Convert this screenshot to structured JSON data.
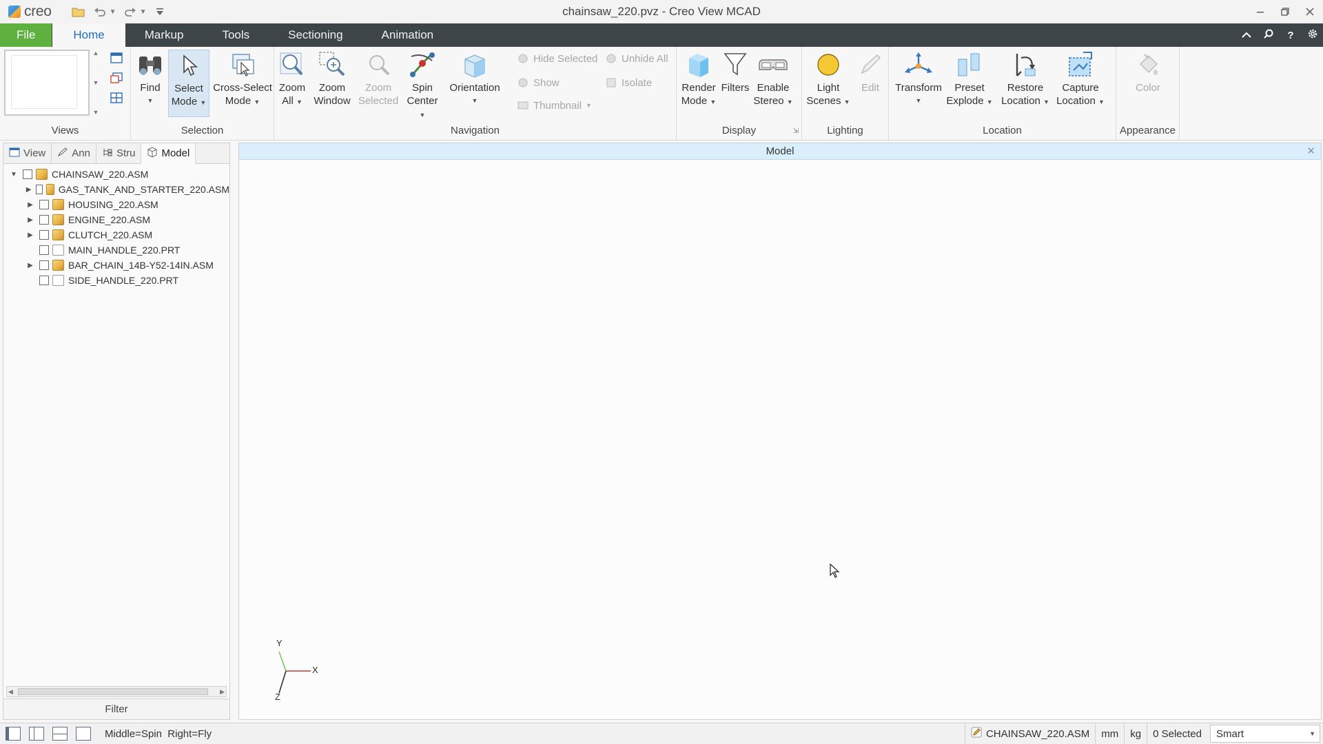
{
  "app": {
    "logo_text": "creo",
    "window_title": "chainsaw_220.pvz - Creo View MCAD"
  },
  "menu_tabs": {
    "file": "File",
    "home": "Home",
    "markup": "Markup",
    "tools": "Tools",
    "sectioning": "Sectioning",
    "animation": "Animation"
  },
  "ribbon": {
    "groups": {
      "views": "Views",
      "selection": "Selection",
      "navigation": "Navigation",
      "display": "Display",
      "lighting": "Lighting",
      "location": "Location",
      "appearance": "Appearance"
    },
    "find": "Find",
    "select_mode_1": "Select",
    "select_mode_2": "Mode",
    "cross_select_1": "Cross-Select",
    "cross_select_2": "Mode",
    "zoom_all_1": "Zoom",
    "zoom_all_2": "All",
    "zoom_window_1": "Zoom",
    "zoom_window_2": "Window",
    "zoom_selected_1": "Zoom",
    "zoom_selected_2": "Selected",
    "spin_center_1": "Spin",
    "spin_center_2": "Center",
    "orientation": "Orientation",
    "hide_selected": "Hide Selected",
    "unhide_all": "Unhide All",
    "show": "Show",
    "isolate": "Isolate",
    "thumbnail": "Thumbnail",
    "render_mode_1": "Render",
    "render_mode_2": "Mode",
    "filters": "Filters",
    "enable_stereo_1": "Enable",
    "enable_stereo_2": "Stereo",
    "light_scenes_1": "Light",
    "light_scenes_2": "Scenes",
    "edit": "Edit",
    "transform": "Transform",
    "preset_explode_1": "Preset",
    "preset_explode_2": "Explode",
    "restore_location_1": "Restore",
    "restore_location_2": "Location",
    "capture_location_1": "Capture",
    "capture_location_2": "Location",
    "color": "Color"
  },
  "left_panel": {
    "tabs": [
      "View",
      "Ann",
      "Stru",
      "Model"
    ],
    "active_tab": "Model",
    "tree": [
      {
        "label": "CHAINSAW_220.ASM",
        "type": "asm",
        "expanded": true,
        "level": 0
      },
      {
        "label": "GAS_TANK_AND_STARTER_220.ASM",
        "type": "asm",
        "expanded": false,
        "level": 1
      },
      {
        "label": "HOUSING_220.ASM",
        "type": "asm",
        "expanded": false,
        "level": 1
      },
      {
        "label": "ENGINE_220.ASM",
        "type": "asm",
        "expanded": false,
        "level": 1
      },
      {
        "label": "CLUTCH_220.ASM",
        "type": "asm",
        "expanded": false,
        "level": 1
      },
      {
        "label": "MAIN_HANDLE_220.PRT",
        "type": "prt",
        "expanded": null,
        "level": 1
      },
      {
        "label": "BAR_CHAIN_14B-Y52-14IN.ASM",
        "type": "asm",
        "expanded": false,
        "level": 1
      },
      {
        "label": "SIDE_HANDLE_220.PRT",
        "type": "prt",
        "expanded": null,
        "level": 1
      }
    ],
    "filter_label": "Filter"
  },
  "viewport": {
    "title": "Model",
    "axis_labels": {
      "x": "X",
      "y": "Y",
      "z": "Z"
    }
  },
  "status_bar": {
    "hint": "Middle=Spin  Right=Fly",
    "model_name": "CHAINSAW_220.ASM",
    "length_unit": "mm",
    "mass_unit": "kg",
    "selection_count": "0 Selected",
    "selection_filter": "Smart"
  },
  "colors": {
    "file_tab": "#5fb13f",
    "tab_bar": "#3d4549",
    "active_tab_text": "#1e6fbf",
    "viewport_header": "#dbeefc"
  }
}
